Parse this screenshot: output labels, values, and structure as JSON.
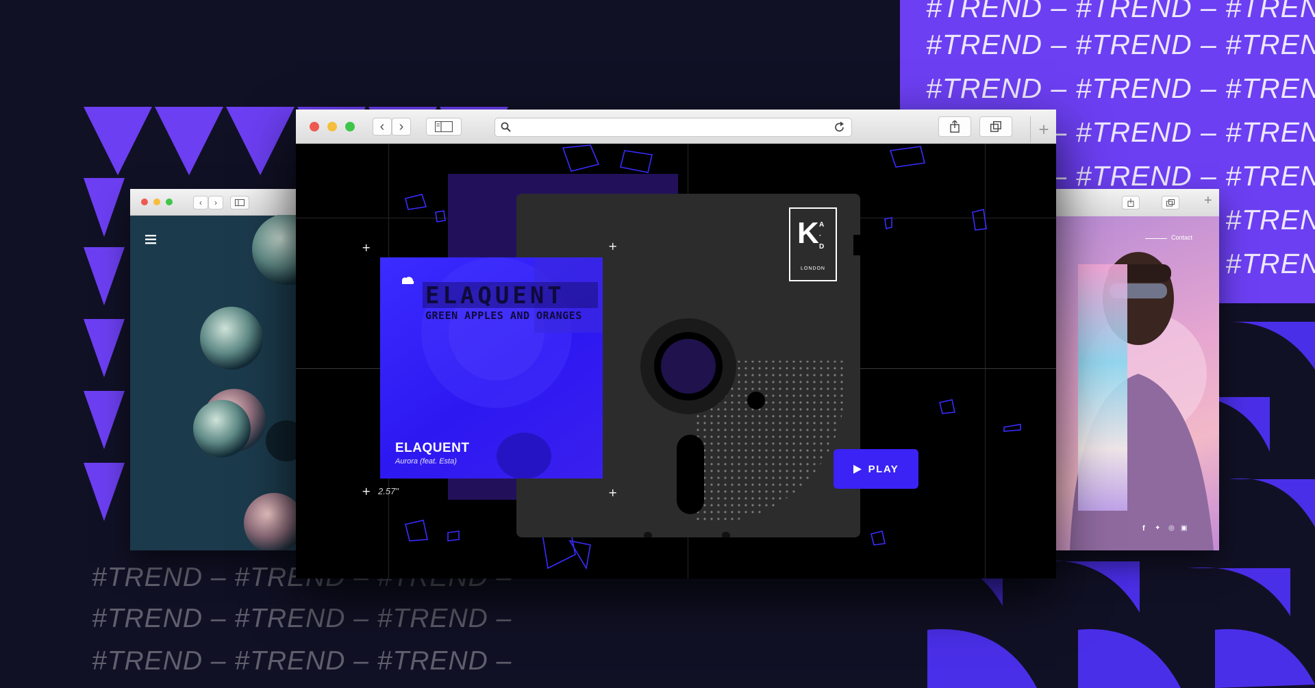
{
  "background": {
    "trend_text": "#TREND – #TREND – #TREND –",
    "accent_color": "#6c3ff2",
    "bg_color": "#111126"
  },
  "main_browser": {
    "url": "",
    "album": {
      "title": "ELAQUENT",
      "subtitle": "GREEN APPLES AND ORANGES",
      "name": "ELAQUENT",
      "track": "Aurora (feat. Esta)"
    },
    "logo": {
      "letter": "K",
      "side_letters": "A\n·\nD",
      "subtext": "LONDON"
    },
    "play_label": "PLAY",
    "measure": "2.57\""
  },
  "right_browser": {
    "nav_link": "Contact"
  },
  "icons": {
    "menu": "hamburger-icon",
    "search": "search-icon",
    "reload": "reload-icon",
    "share": "share-icon",
    "tabs": "tabs-icon",
    "play": "play-icon",
    "cloud": "soundcloud-icon"
  }
}
